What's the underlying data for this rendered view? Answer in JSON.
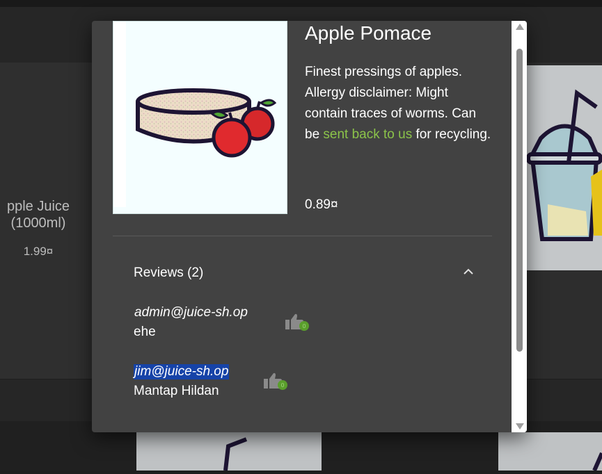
{
  "background": {
    "left_product_name": "pple Juice\n(1000ml)",
    "left_product_name_line1": "pple Juice",
    "left_product_name_line2": "(1000ml)",
    "left_product_price": "1.99¤"
  },
  "dialog": {
    "product": {
      "title": "Apple Pomace",
      "description_part1": "Finest pressings of apples. Allergy disclaimer: Might contain traces of worms. Can be ",
      "description_link": "sent back to us",
      "description_part2": " for recycling.",
      "price": "0.89¤",
      "image_icon": "apple-pomace-image"
    },
    "reviews": {
      "title": "Reviews (2)",
      "toggle_icon": "chevron-up-icon",
      "items": [
        {
          "author": "admin@juice-sh.op",
          "text": "ehe",
          "selected": false
        },
        {
          "author": "jim@juice-sh.op",
          "text": "Mantap Hildan",
          "selected": true
        }
      ]
    }
  },
  "colors": {
    "dialog_bg": "#424242",
    "link": "#8bc34a",
    "selection": "#1643a8",
    "like_badge": "#5a9e2c"
  }
}
